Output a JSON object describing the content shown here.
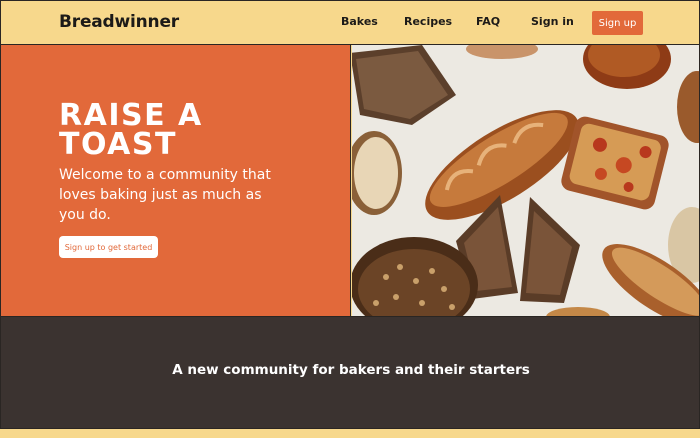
{
  "nav": {
    "logo": "Breadwinner",
    "links": [
      "Bakes",
      "Recipes",
      "FAQ",
      "Sign in"
    ],
    "signup": "Sign up"
  },
  "hero": {
    "title": "Raise a toast",
    "subtitle": "Welcome to a community that loves baking just as much as you do.",
    "cta": "Sign up to get started",
    "image_icon": "bread-photo-icon"
  },
  "community": {
    "heading": "A new community for bakers and their starters"
  },
  "colors": {
    "accent": "#e2693a",
    "nav_bg": "#f7d88c",
    "dark": "#3b3330"
  }
}
